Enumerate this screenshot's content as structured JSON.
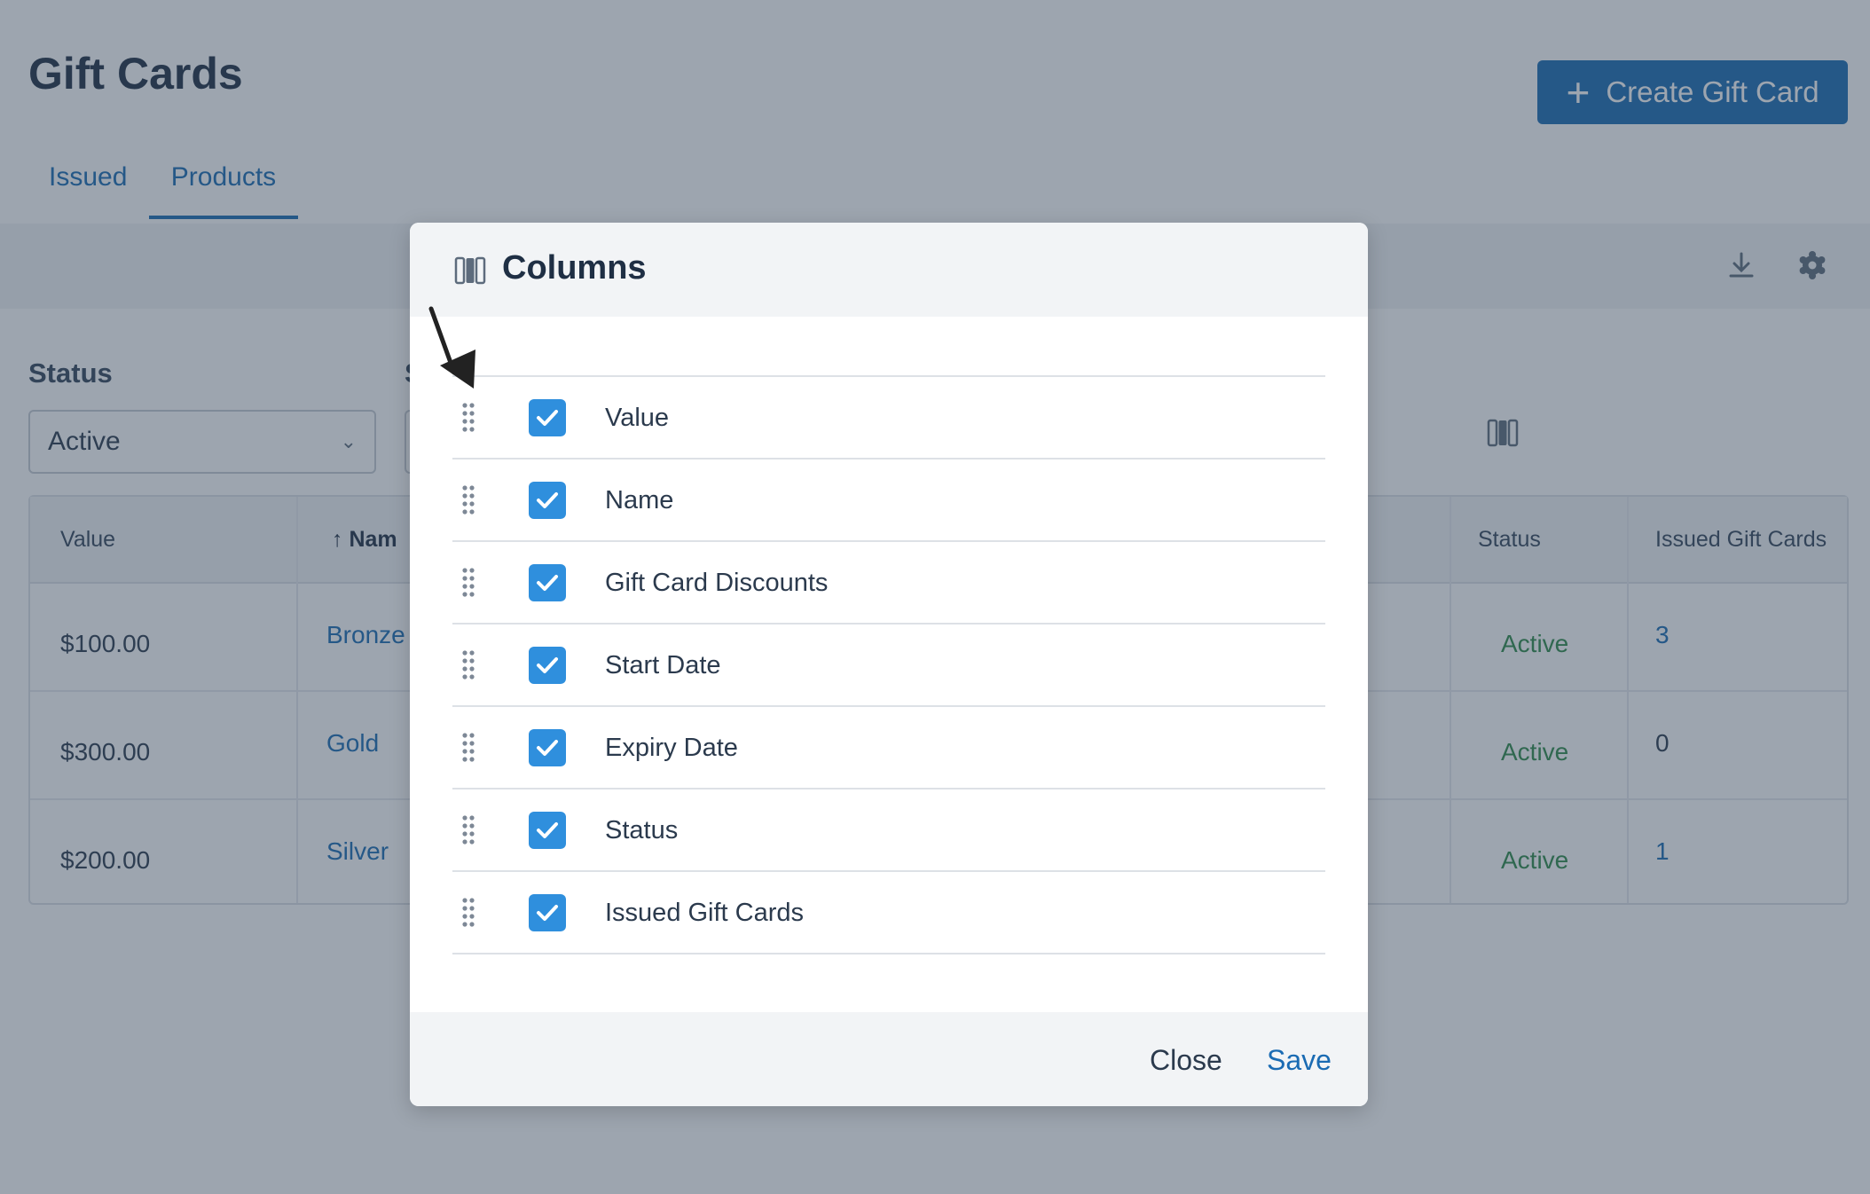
{
  "page": {
    "title": "Gift Cards",
    "create_button_label": "Create Gift Card",
    "tabs": [
      {
        "label": "Issued"
      },
      {
        "label": "Products"
      }
    ],
    "status_filter": {
      "label": "Status",
      "value": "Active",
      "second_filter_label_fragment": "S"
    },
    "table": {
      "headers": {
        "value": "Value",
        "name": "Nam",
        "status": "Status",
        "issued": "Issued Gift Cards"
      },
      "sort_indicator": "↑",
      "rows": [
        {
          "value": "$100.00",
          "name": "Bronze",
          "status": "Active",
          "issued": "3"
        },
        {
          "value": "$300.00",
          "name": "Gold",
          "status": "Active",
          "issued": "0"
        },
        {
          "value": "$200.00",
          "name": "Silver",
          "status": "Active",
          "issued": "1"
        }
      ]
    },
    "icons": {
      "download": "download-icon",
      "settings": "gear-icon",
      "columns": "columns-icon"
    }
  },
  "modal": {
    "title": "Columns",
    "columns": [
      {
        "label": "Value",
        "checked": true
      },
      {
        "label": "Name",
        "checked": true
      },
      {
        "label": "Gift Card Discounts",
        "checked": true
      },
      {
        "label": "Start Date",
        "checked": true
      },
      {
        "label": "Expiry Date",
        "checked": true
      },
      {
        "label": "Status",
        "checked": true
      },
      {
        "label": "Issued Gift Cards",
        "checked": true
      }
    ],
    "close_label": "Close",
    "save_label": "Save"
  },
  "colors": {
    "primary": "#1a6bb3",
    "checkbox": "#2f8fdd",
    "status_active": "#2e8b4a",
    "overlay": "#324258"
  }
}
